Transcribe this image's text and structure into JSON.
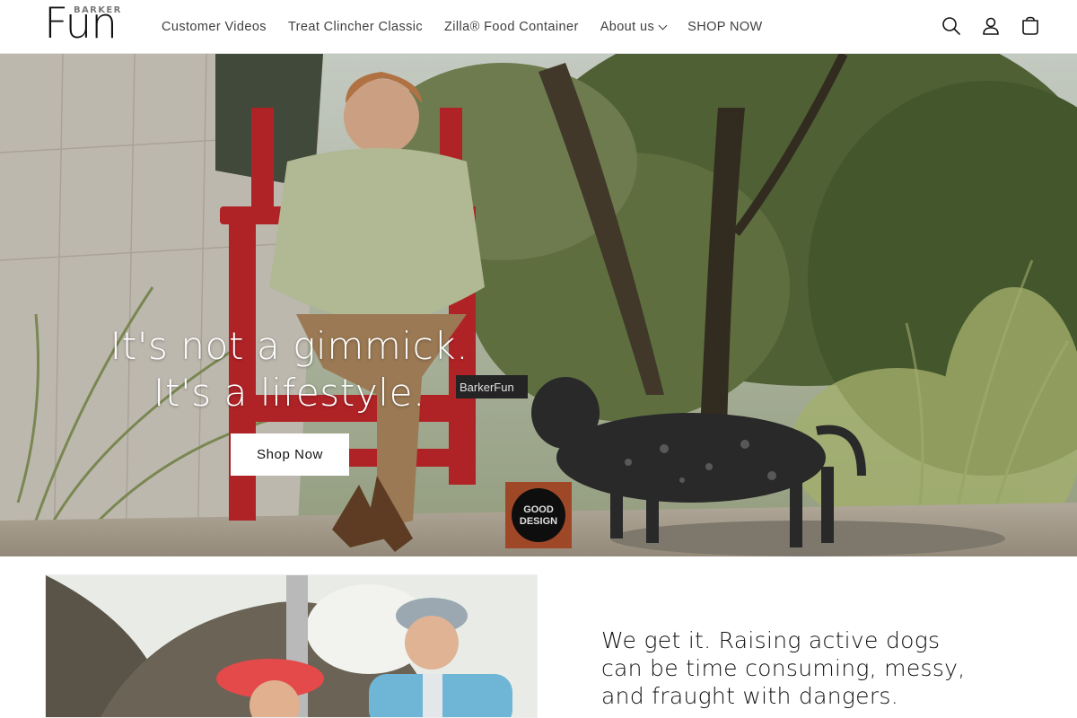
{
  "brand": {
    "logo_top": "BARKER",
    "logo_main": "Fun"
  },
  "nav": {
    "items": [
      {
        "label": "Customer Videos"
      },
      {
        "label": "Treat Clincher Classic"
      },
      {
        "label": "Zilla® Food Container"
      },
      {
        "label": "About us"
      },
      {
        "label": "SHOP NOW"
      }
    ]
  },
  "header_icons": [
    "search-icon",
    "account-icon",
    "cart-icon"
  ],
  "hero": {
    "heading": "It's not a gimmick. It's a lifestyle.",
    "button_label": "Shop Now",
    "product_label": "BarkerFun",
    "badge_line1": "GOOD",
    "badge_line2": "DESIGN"
  },
  "section": {
    "text": "We get it. Raising active dogs can be time consuming, messy, and fraught with dangers."
  },
  "colors": {
    "text": "#121212",
    "nav_text": "#3f3f3f",
    "chair_red": "#c8282c",
    "badge_bg": "#b5522e"
  }
}
